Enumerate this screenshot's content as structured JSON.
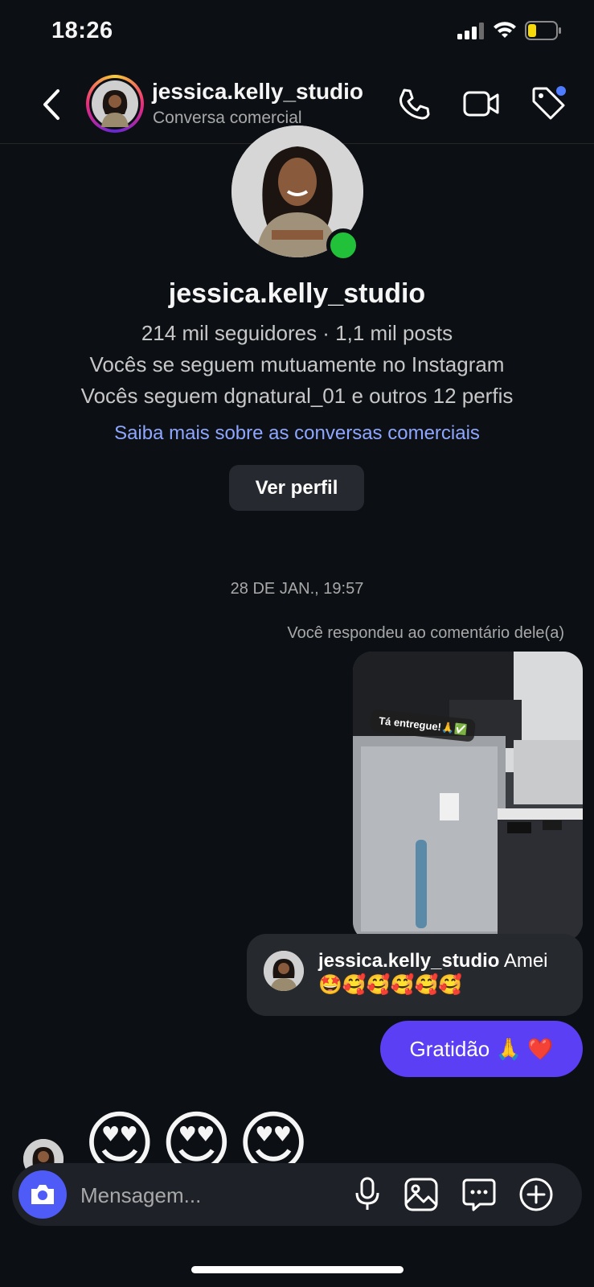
{
  "status_bar": {
    "time": "18:26",
    "battery_color": "#f5d90a"
  },
  "header": {
    "name": "jessica.kelly_studio",
    "subtitle": "Conversa comercial",
    "icons": [
      "chevron-left-icon",
      "phone-icon",
      "video-camera-icon",
      "tag-icon"
    ],
    "tag_badge_color": "#4f7bff"
  },
  "profile": {
    "name": "jessica.kelly_studio",
    "stats": "214 mil seguidores · 1,1 mil posts",
    "mutual": "Vocês se seguem mutuamente no Instagram",
    "following": "Vocês seguem dgnatural_01 e outros 12 perfis",
    "learn_more": "Saiba mais sobre as conversas comerciais",
    "view_profile": "Ver perfil",
    "online_color": "#22c13a"
  },
  "conversation": {
    "date": "28 DE JAN., 19:57",
    "reply_note": "Você respondeu ao comentário dele(a)",
    "photo_sticker": "Tá entregue!🙏✅",
    "reply": {
      "user": "jessica.kelly_studio",
      "text": " Amei 🤩🥰🥰🥰🥰🥰"
    },
    "sent": "Gratidão 🙏 ❤️",
    "received_emojis": "😍😍😍",
    "sent_color": "#5b3ff5"
  },
  "composer": {
    "placeholder": "Mensagem...",
    "icons": [
      "camera-icon",
      "microphone-icon",
      "gallery-icon",
      "sticker-chat-icon",
      "plus-circle-icon"
    ],
    "camera_color": "#4f5bf7"
  }
}
